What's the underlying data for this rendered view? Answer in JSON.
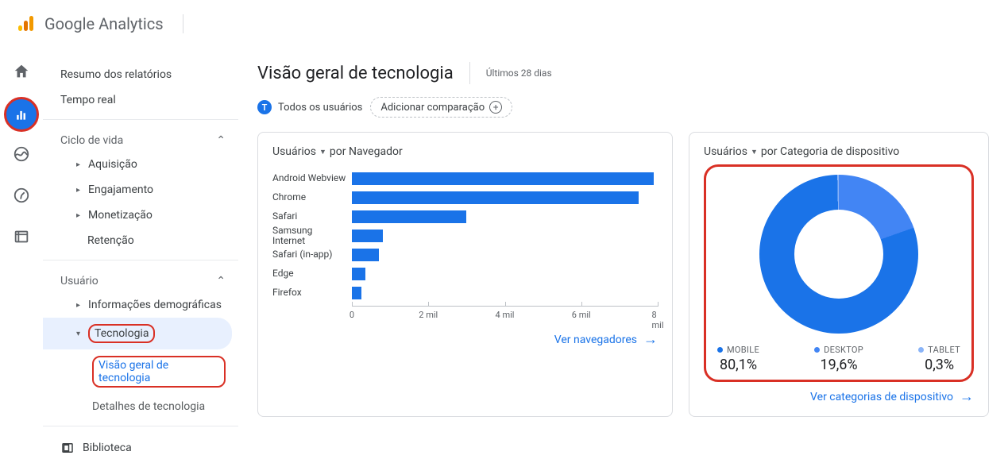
{
  "brand": "Google Analytics",
  "rail": {
    "icons": [
      "home",
      "reports",
      "explore",
      "advertise",
      "configure"
    ]
  },
  "sidebar": {
    "report_summary": "Resumo dos relatórios",
    "realtime": "Tempo real",
    "lifecycle": {
      "title": "Ciclo de vida",
      "items": [
        "Aquisição",
        "Engajamento",
        "Monetização",
        "Retenção"
      ]
    },
    "user": {
      "title": "Usuário",
      "demographics": "Informações demográficas",
      "technology": {
        "label": "Tecnologia",
        "overview": "Visão geral de tecnologia",
        "details": "Detalhes de tecnologia"
      }
    },
    "library": "Biblioteca"
  },
  "page": {
    "title": "Visão geral de tecnologia",
    "date_range": "Últimos 28 dias",
    "chip_all_users": "Todos os usuários",
    "chip_add_compare": "Adicionar comparação"
  },
  "card_browser": {
    "metric_label": "Usuários",
    "by_label": "por Navegador",
    "footer": "Ver navegadores"
  },
  "card_device": {
    "metric_label": "Usuários",
    "by_label": "por Categoria de dispositivo",
    "legend": [
      {
        "label": "MOBILE",
        "value": "80,1%",
        "color": "#1a73e8"
      },
      {
        "label": "DESKTOP",
        "value": "19,6%",
        "color": "#4285f4"
      },
      {
        "label": "TABLET",
        "value": "0,3%",
        "color": "#8ab4f8"
      }
    ],
    "footer": "Ver categorias de dispositivo"
  },
  "chart_data": [
    {
      "type": "bar",
      "title": "Usuários por Navegador",
      "xlabel": "",
      "ylabel": "",
      "xlim": [
        0,
        8000
      ],
      "ticks": [
        0,
        2000,
        4000,
        6000,
        8000
      ],
      "tick_labels": [
        "0",
        "2 mil",
        "4 mil",
        "6 mil",
        "8 mil"
      ],
      "categories": [
        "Android Webview",
        "Chrome",
        "Safari",
        "Samsung Internet",
        "Safari (in-app)",
        "Edge",
        "Firefox"
      ],
      "values": [
        7900,
        7500,
        3000,
        800,
        700,
        350,
        250
      ]
    },
    {
      "type": "pie",
      "title": "Usuários por Categoria de dispositivo",
      "categories": [
        "MOBILE",
        "DESKTOP",
        "TABLET"
      ],
      "values": [
        80.1,
        19.6,
        0.3
      ]
    }
  ]
}
